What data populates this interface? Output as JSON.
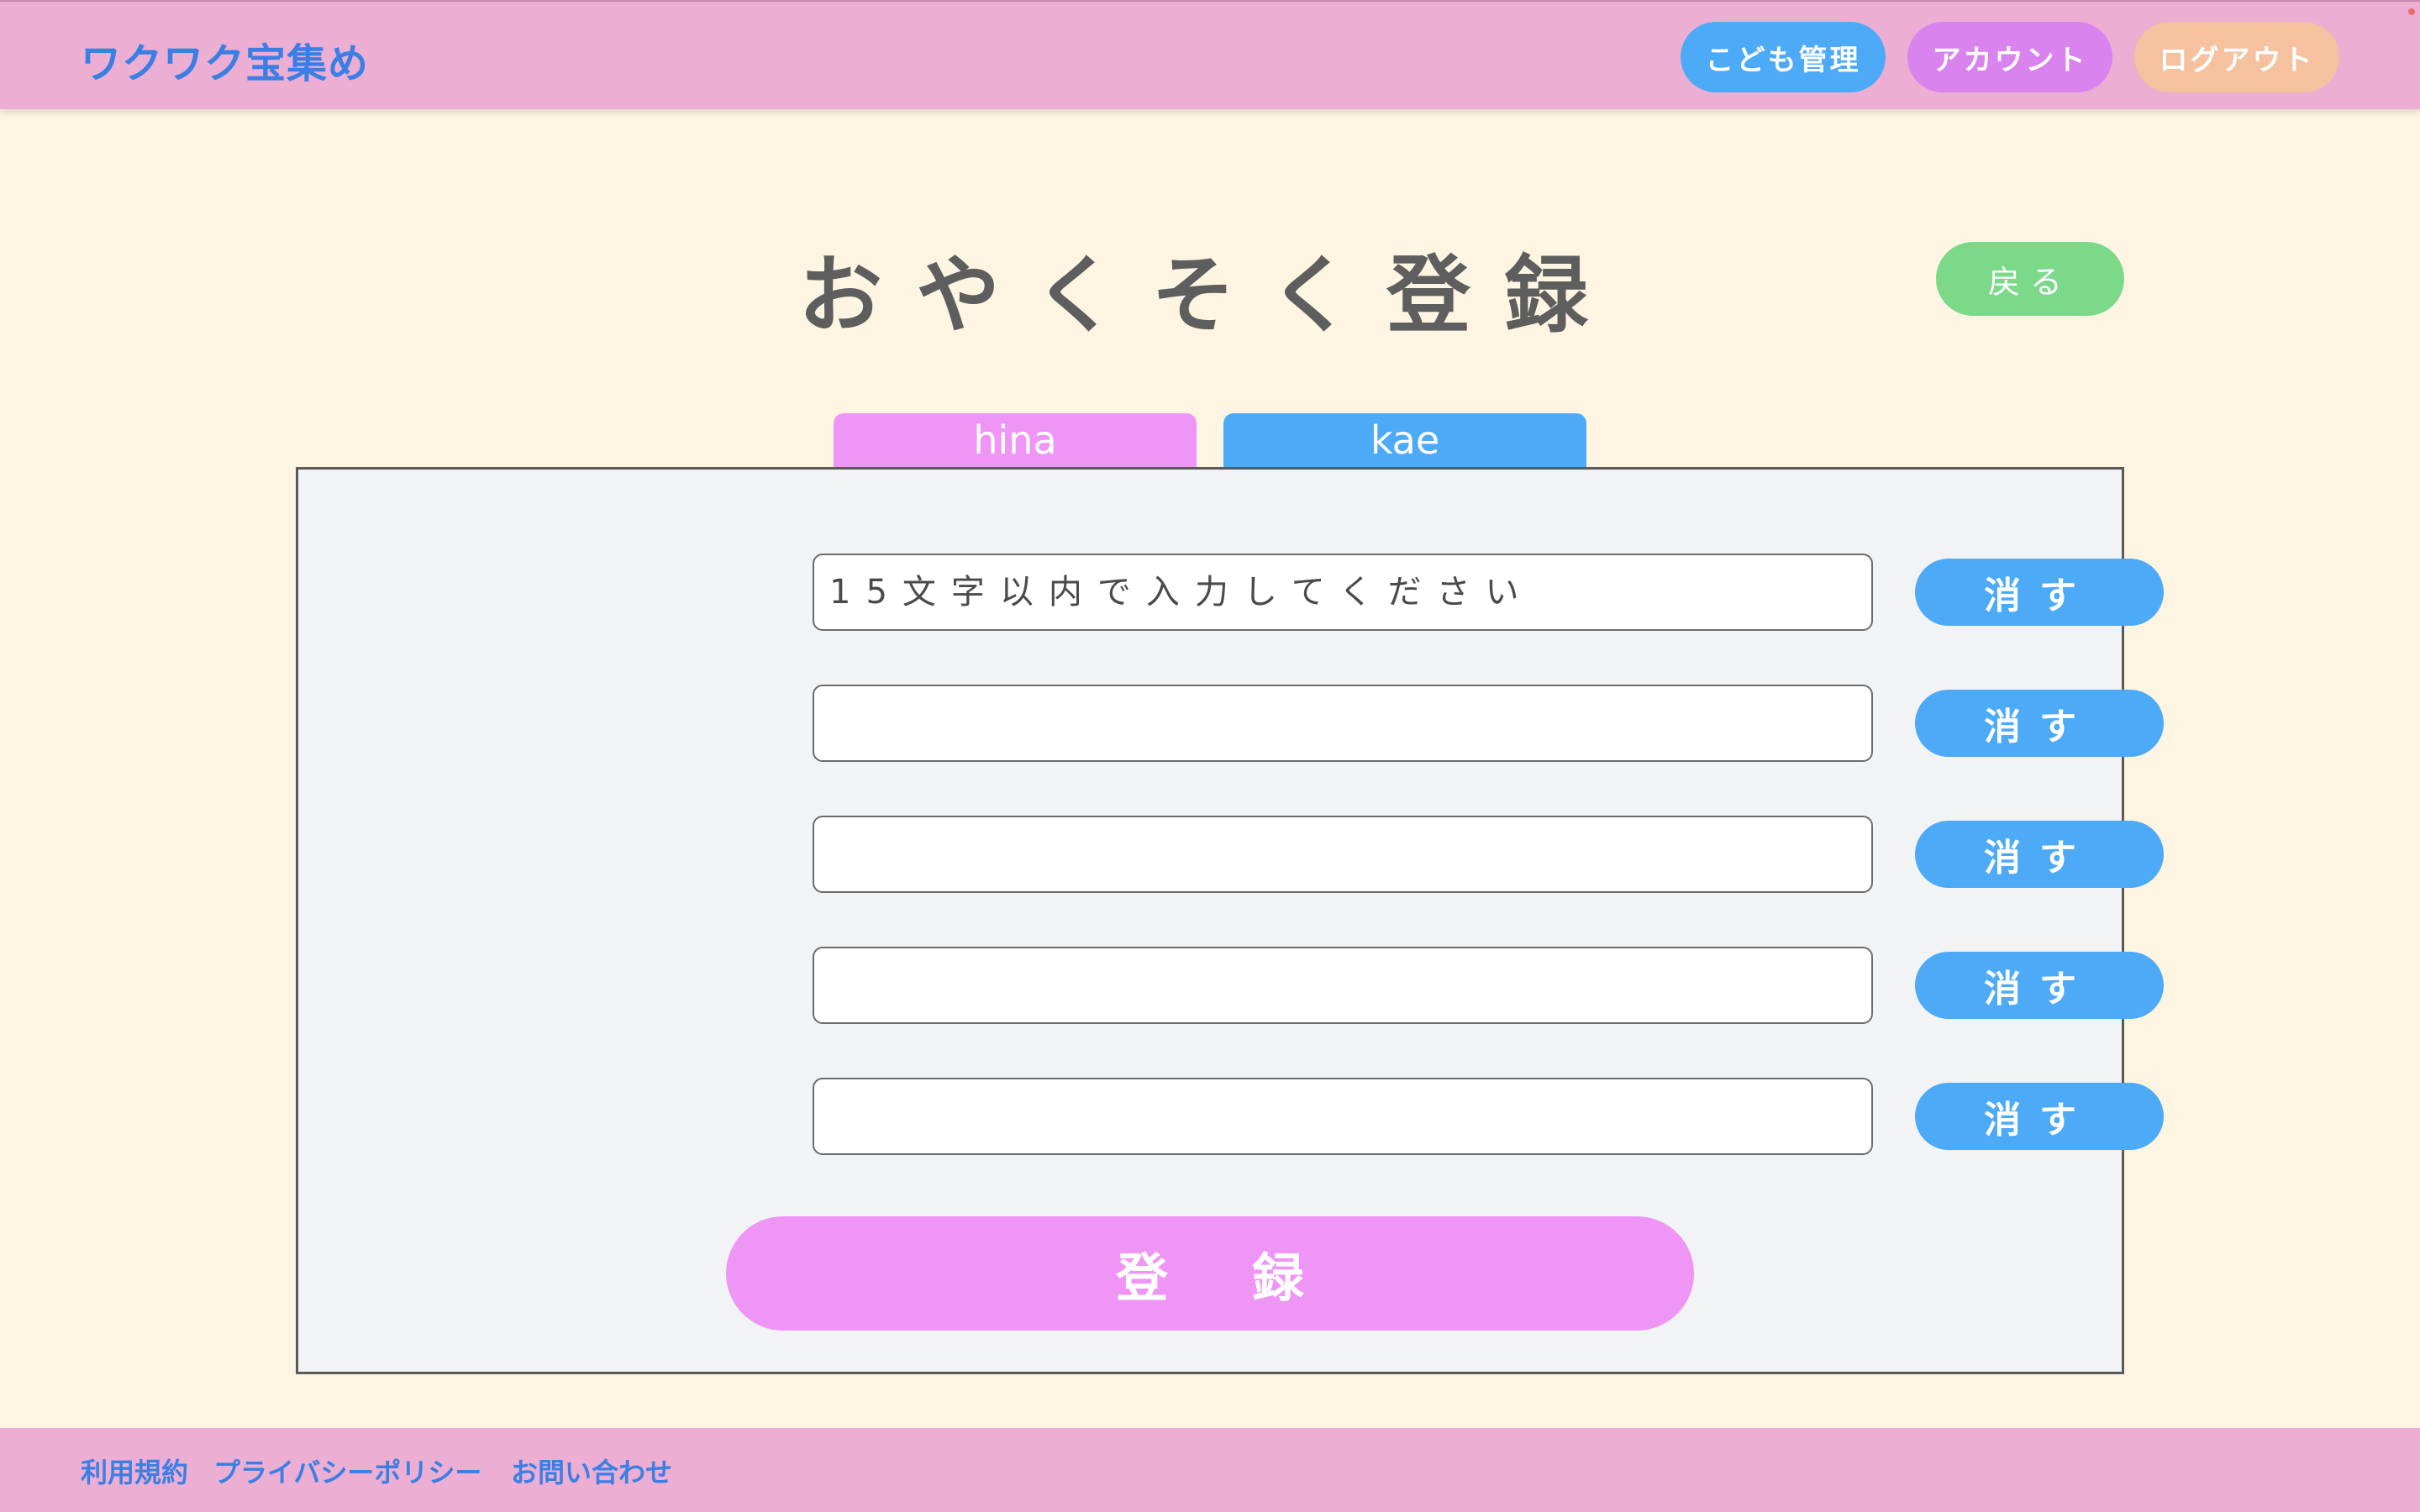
{
  "header": {
    "logo": "ワクワク宝集め",
    "nav": {
      "kids": "こども管理",
      "account": "アカウント",
      "logout": "ログアウト"
    }
  },
  "main": {
    "title": "おやくそく登録",
    "back_label": "戻る",
    "tabs": [
      {
        "label": "hina"
      },
      {
        "label": "kae"
      }
    ],
    "form": {
      "placeholder": "15文字以内で入力してください",
      "fields": [
        {
          "value": "",
          "delete_label": "消す"
        },
        {
          "value": "",
          "delete_label": "消す"
        },
        {
          "value": "",
          "delete_label": "消す"
        },
        {
          "value": "",
          "delete_label": "消す"
        },
        {
          "value": "",
          "delete_label": "消す"
        }
      ],
      "submit_label": "登録"
    }
  },
  "footer": {
    "links": [
      "利用規約",
      "プライバシーポリシー",
      "お問い合わせ"
    ]
  },
  "colors": {
    "background": "#fdf5e2",
    "header_footer": "#ecaed3",
    "blue": "#4daaf7",
    "purple": "#d983ee",
    "peach": "#f5c19e",
    "green": "#7cd98a",
    "pink": "#ee95f5",
    "link_blue": "#3a7fe3"
  }
}
